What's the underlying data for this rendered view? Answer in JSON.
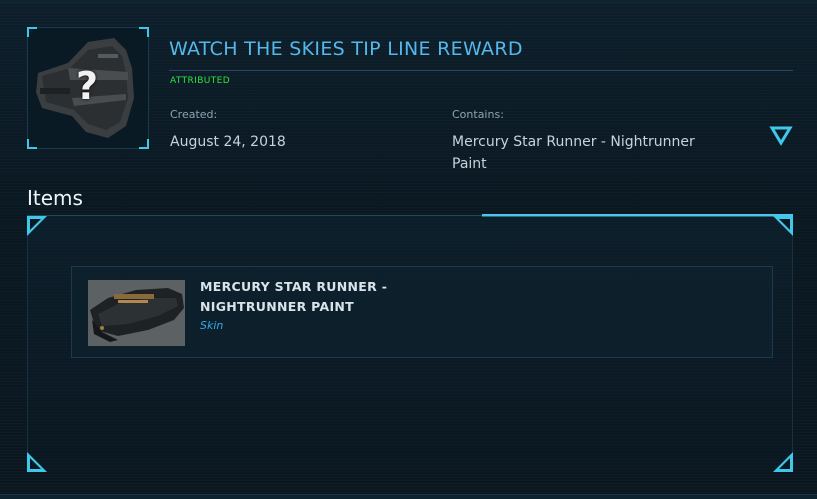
{
  "header": {
    "title": "WATCH THE SKIES TIP LINE REWARD",
    "status": "ATTRIBUTED",
    "created_label": "Created:",
    "created_value": "August 24, 2018",
    "contains_label": "Contains:",
    "contains_value": "Mercury Star Runner - Nightrunner Paint",
    "thumbnail_icon": "question-mark-icon"
  },
  "items_section": {
    "heading": "Items",
    "items": [
      {
        "name": "MERCURY STAR RUNNER - NIGHTRUNNER PAINT",
        "type": "Skin"
      }
    ]
  },
  "colors": {
    "accent": "#53b8ea",
    "status_green": "#2fe33e",
    "corner_cyan": "#3ec8ec",
    "item_type_blue": "#3aa6e6"
  }
}
